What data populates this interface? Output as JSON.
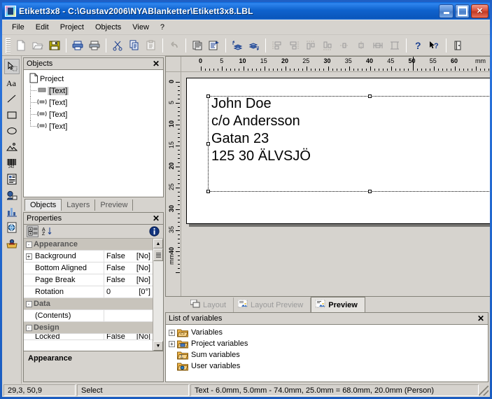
{
  "window": {
    "title": "Etikett3x8 - C:\\Gustav2006\\NYABlanketter\\Etikett3x8.LBL",
    "app_icon": "label-designer-icon",
    "minimize_label": "Minimize",
    "maximize_label": "Maximize",
    "close_label": "Close"
  },
  "menu": {
    "items": [
      {
        "label": "File"
      },
      {
        "label": "Edit"
      },
      {
        "label": "Project"
      },
      {
        "label": "Objects"
      },
      {
        "label": "View"
      },
      {
        "label": "?"
      }
    ]
  },
  "toolbar": {
    "buttons": [
      {
        "name": "new-file-icon",
        "tip": "New",
        "enabled": false
      },
      {
        "name": "open-folder-icon",
        "tip": "Open",
        "enabled": false
      },
      {
        "name": "save-disk-icon",
        "tip": "Save",
        "enabled": true
      },
      {
        "name": "print-icon",
        "tip": "Print",
        "enabled": true
      },
      {
        "name": "print-preview-icon",
        "tip": "Print Preview",
        "enabled": true
      },
      {
        "name": "cut-scissors-icon",
        "tip": "Cut",
        "enabled": true
      },
      {
        "name": "copy-icon",
        "tip": "Copy",
        "enabled": true
      },
      {
        "name": "paste-icon",
        "tip": "Paste",
        "enabled": false
      },
      {
        "name": "undo-arrow-icon",
        "tip": "Undo",
        "enabled": false
      },
      {
        "name": "page-setup-icon",
        "tip": "Page Setup",
        "enabled": true
      },
      {
        "name": "project-properties-icon",
        "tip": "Project Properties",
        "enabled": true
      },
      {
        "name": "bring-to-front-icon",
        "tip": "Bring To Front",
        "enabled": true
      },
      {
        "name": "send-to-back-icon",
        "tip": "Send To Back",
        "enabled": true
      },
      {
        "name": "align-left-icon",
        "tip": "Align Left",
        "enabled": false
      },
      {
        "name": "align-right-icon",
        "tip": "Align Right",
        "enabled": false
      },
      {
        "name": "align-top-icon",
        "tip": "Align Top",
        "enabled": false
      },
      {
        "name": "align-bottom-icon",
        "tip": "Align Bottom",
        "enabled": false
      },
      {
        "name": "center-horizontal-icon",
        "tip": "Center Horizontally",
        "enabled": false
      },
      {
        "name": "center-vertical-icon",
        "tip": "Center Vertically",
        "enabled": false
      },
      {
        "name": "same-width-icon",
        "tip": "Same Width",
        "enabled": false
      },
      {
        "name": "same-height-icon",
        "tip": "Same Height",
        "enabled": false
      },
      {
        "name": "help-question-icon",
        "tip": "Help",
        "enabled": true
      },
      {
        "name": "context-help-icon",
        "tip": "Context Help",
        "enabled": true
      },
      {
        "name": "exit-door-icon",
        "tip": "Exit",
        "enabled": true
      }
    ]
  },
  "object_tools": {
    "items": [
      {
        "name": "select-arrow-tool",
        "tip": "Select",
        "active": true
      },
      {
        "name": "text-tool",
        "tip": "Text",
        "glyph": "Aa",
        "active": false
      },
      {
        "name": "line-tool",
        "tip": "Line",
        "active": false
      },
      {
        "name": "rectangle-tool",
        "tip": "Rectangle",
        "active": false
      },
      {
        "name": "ellipse-tool",
        "tip": "Ellipse",
        "active": false
      },
      {
        "name": "picture-tool",
        "tip": "Picture",
        "active": false
      },
      {
        "name": "barcode-tool",
        "tip": "Barcode",
        "glyph": "242",
        "active": false
      },
      {
        "name": "rich-text-tool",
        "tip": "Formatted Text",
        "active": false
      },
      {
        "name": "ole-object-tool",
        "tip": "OLE Object",
        "active": false
      },
      {
        "name": "chart-tool",
        "tip": "Chart",
        "active": false
      },
      {
        "name": "html-tool",
        "tip": "HTML Object",
        "active": false
      },
      {
        "name": "export-tool",
        "tip": "Export",
        "active": false
      }
    ]
  },
  "objects_panel": {
    "title": "Objects",
    "close_label": "✕",
    "root": {
      "label": "Project",
      "icon": "document-icon"
    },
    "children": [
      {
        "label": "[Text]",
        "icon": "text-object-icon",
        "selected": true
      },
      {
        "label": "[Text]",
        "icon": "text-object-icon",
        "selected": false
      },
      {
        "label": "[Text]",
        "icon": "text-object-icon",
        "selected": false
      },
      {
        "label": "[Text]",
        "icon": "text-object-icon",
        "selected": false
      }
    ],
    "tabs": [
      {
        "label": "Objects",
        "active": true
      },
      {
        "label": "Layers",
        "active": false
      },
      {
        "label": "Preview",
        "active": false
      }
    ]
  },
  "properties_panel": {
    "title": "Properties",
    "close_label": "✕",
    "toolbar": [
      {
        "name": "categorized-view-icon",
        "active": true
      },
      {
        "name": "alphabetical-sort-icon",
        "active": false
      },
      {
        "name": "info-icon",
        "active": false
      }
    ],
    "rows": [
      {
        "kind": "category",
        "expander": "-",
        "name": "Appearance",
        "value": "",
        "suffix": ""
      },
      {
        "kind": "prop",
        "expander": "+",
        "name": "Background",
        "value": "False",
        "suffix": "[No]"
      },
      {
        "kind": "prop",
        "expander": "",
        "name": "Bottom Aligned",
        "value": "False",
        "suffix": "[No]"
      },
      {
        "kind": "prop",
        "expander": "",
        "name": "Page Break",
        "value": "False",
        "suffix": "[No]"
      },
      {
        "kind": "prop",
        "expander": "",
        "name": "Rotation",
        "value": "0",
        "suffix": "[0°]"
      },
      {
        "kind": "category",
        "expander": "-",
        "name": "Data",
        "value": "",
        "suffix": ""
      },
      {
        "kind": "prop",
        "expander": "",
        "name": "(Contents)",
        "value": "",
        "suffix": ""
      },
      {
        "kind": "category",
        "expander": "-",
        "name": "Design",
        "value": "",
        "suffix": ""
      },
      {
        "kind": "prop",
        "expander": "",
        "name": "Locked",
        "value": "False",
        "suffix": "[No]"
      }
    ],
    "description": "Appearance"
  },
  "workspace": {
    "h_ruler": {
      "unit": "mm",
      "labels": [
        0,
        5,
        10,
        15,
        20,
        25,
        30,
        35,
        40,
        45,
        50,
        55,
        60
      ],
      "marker_at": 50
    },
    "v_ruler": {
      "unit": "mm",
      "labels": [
        0,
        5,
        10,
        15,
        20,
        25,
        30,
        35,
        40
      ]
    },
    "label_object": {
      "lines": [
        "John Doe",
        "c/o Andersson",
        "Gatan 23",
        "125 30 ÄLVSJÖ"
      ],
      "selected": true
    },
    "view_tabs": [
      {
        "label": "Layout",
        "icon": "layout-icon",
        "active": false
      },
      {
        "label": "Layout Preview",
        "icon": "layout-preview-icon",
        "active": false
      },
      {
        "label": "Preview",
        "icon": "preview-icon",
        "active": true
      }
    ]
  },
  "variables_panel": {
    "title": "List of variables",
    "close_label": "✕",
    "items": [
      {
        "label": "Variables",
        "expander": "+",
        "icon": "variables-folder-icon"
      },
      {
        "label": "Project variables",
        "expander": "+",
        "icon": "project-variables-folder-icon"
      },
      {
        "label": "Sum variables",
        "expander": "",
        "icon": "sum-variables-folder-icon"
      },
      {
        "label": "User variables",
        "expander": "",
        "icon": "user-variables-folder-icon"
      }
    ]
  },
  "statusbar": {
    "coordinates": "29,3, 50,9",
    "mode": "Select",
    "selection_info": "Text  -  6.0mm, 5.0mm  -  74.0mm, 25.0mm  =  68.0mm, 20.0mm (Person)"
  },
  "colors": {
    "title_blue": "#0f63ce",
    "face": "#d6d3ce",
    "border": "#848279",
    "accent_blue": "#1b3f8f"
  }
}
